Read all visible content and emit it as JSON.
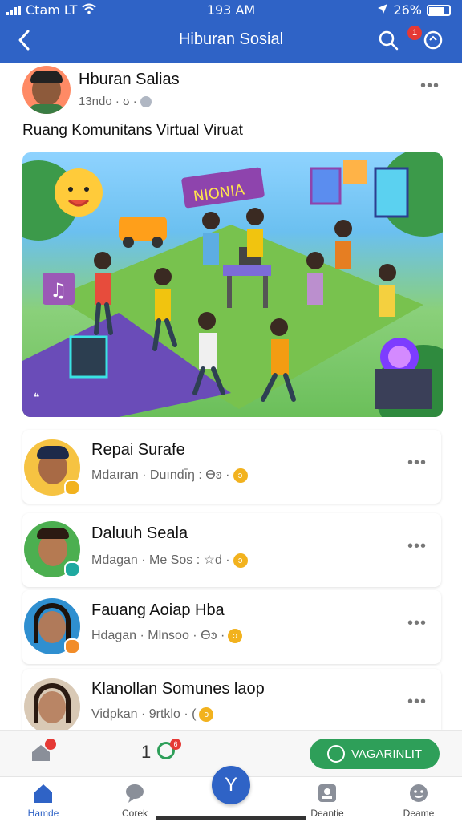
{
  "status_bar": {
    "carrier": "Ctam LT",
    "time": "193 AM",
    "battery": "26%"
  },
  "header": {
    "title": "Hiburan Sosial",
    "notification_badge": "1"
  },
  "post": {
    "author": "Hburan Salias",
    "meta": "13ndo · ʊ ·",
    "text": "Ruang Komunitans Virtual Viruat",
    "image_sign": "NIONIA"
  },
  "cards": [
    {
      "name": "Repai Surafe",
      "sub": "Mdaıran · Duındı̄ŋ : Ɵͽ ·"
    },
    {
      "name": "Daluuh Seala",
      "sub": "Mdagan · Me Sos : ☆d ·"
    },
    {
      "name": "Fauang Aoiap Hba",
      "sub": "Hdagan · Mlnsoo · Ɵͽ ·"
    },
    {
      "name": "Klanollan Somunes laop",
      "sub": "Vidpkan · 9rtklo · ("
    }
  ],
  "action_bar": {
    "count": "1",
    "count_badge": "6",
    "button_label": "VAGARINLIT"
  },
  "nav": [
    {
      "label": "Hamde"
    },
    {
      "label": "Corek"
    },
    {
      "label": "Y"
    },
    {
      "label": "Deantie"
    },
    {
      "label": "Deame"
    }
  ],
  "colors": {
    "brand_blue": "#2f63c6",
    "accent_green": "#2e9f59",
    "badge_red": "#e53935",
    "badge_yellow": "#f2b21e"
  }
}
